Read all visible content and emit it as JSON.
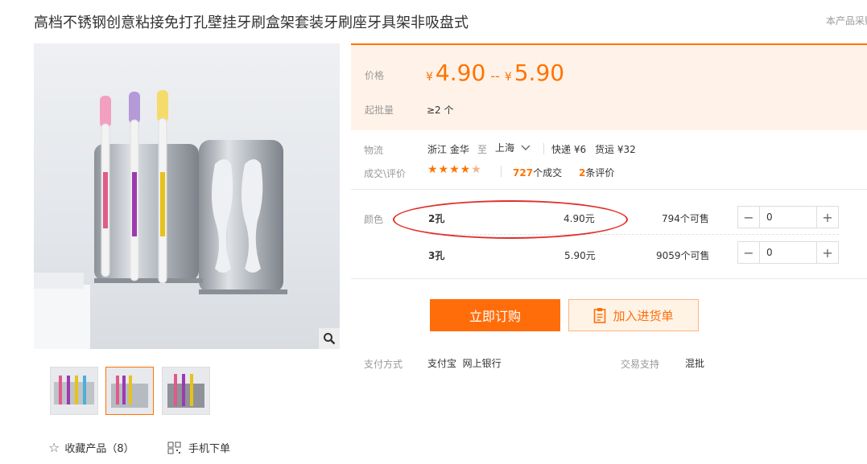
{
  "product": {
    "title": "高档不锈钢创意粘接免打孔壁挂牙刷盒架套装牙刷座牙具架非吸盘式",
    "source_note": "本产品采购"
  },
  "gallery": {
    "thumbnails": [
      "thumb-1",
      "thumb-2",
      "thumb-3"
    ],
    "active_index": 1
  },
  "actions": {
    "favorite_label": "收藏产品（8）",
    "mobile_label": "手机下单"
  },
  "price": {
    "label": "价格",
    "currency": "¥",
    "low": "4.90",
    "sep": "--",
    "high": "5.90",
    "moq_label": "起批量",
    "moq_value": "≥2 个"
  },
  "logistics": {
    "label": "物流",
    "origin": "浙江 金华",
    "to": "至",
    "destination": "上海",
    "express": "快递 ¥6",
    "freight": "货运 ¥32"
  },
  "reviews": {
    "label": "成交\\评价",
    "rating": 4.5,
    "deals_count": "727",
    "deals_label": "个成交",
    "review_count": "2",
    "review_label": "条评价"
  },
  "variants": {
    "label": "颜色",
    "items": [
      {
        "name": "2孔",
        "price": "4.90元",
        "stock": "794个可售",
        "qty": "0"
      },
      {
        "name": "3孔",
        "price": "5.90元",
        "stock": "9059个可售",
        "qty": "0"
      }
    ]
  },
  "buttons": {
    "buy_now": "立即订购",
    "add_to_cart": "加入进货单"
  },
  "payment": {
    "label": "支付方式",
    "methods": "支付宝  网上银行",
    "support_label": "交易支持",
    "support_value": "混批"
  },
  "colors": {
    "accent": "#ff7300",
    "highlight": "#e0302a"
  }
}
